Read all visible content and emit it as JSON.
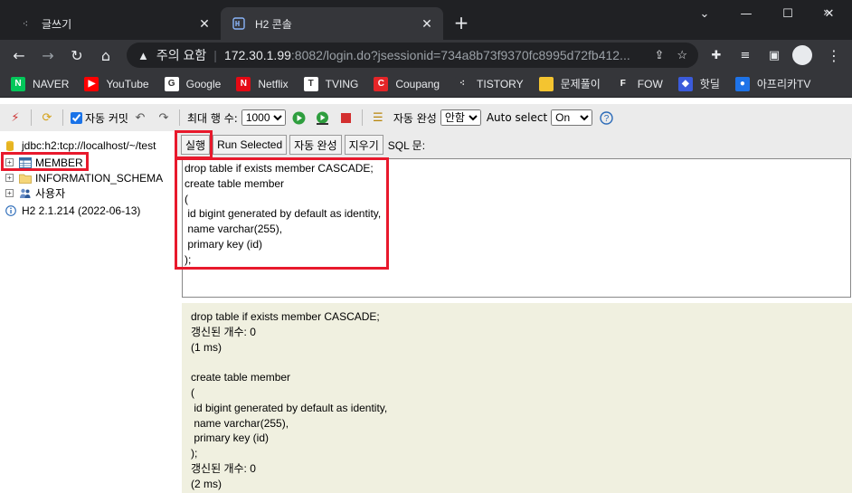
{
  "browser": {
    "tabs": [
      {
        "title": "글쓰기",
        "favicon": "tistory-dots-icon",
        "active": false
      },
      {
        "title": "H2 콘솔",
        "favicon": "h2-icon",
        "active": true
      }
    ],
    "window_controls": [
      "chevron-down-icon",
      "minimize-icon",
      "maximize-icon",
      "close-icon"
    ],
    "address": {
      "security": "주의 요함",
      "host": "172.30.1.99",
      "path": ":8082/login.do?jsessionid=734a8b73f9370fc8995d72fb412..."
    },
    "bookmarks": [
      {
        "label": "NAVER",
        "color": "#03c75a",
        "glyph": "N"
      },
      {
        "label": "YouTube",
        "color": "#ff0000",
        "glyph": "▶"
      },
      {
        "label": "Google",
        "color": "#ffffff",
        "glyph": "G"
      },
      {
        "label": "Netflix",
        "color": "#e50914",
        "glyph": "N"
      },
      {
        "label": "TVING",
        "color": "#ffffff",
        "glyph": "T"
      },
      {
        "label": "Coupang",
        "color": "#e52528",
        "glyph": "C"
      },
      {
        "label": "TISTORY",
        "color": "#35363a",
        "glyph": "⁖"
      },
      {
        "label": "문제풀이",
        "color": "#f4c430",
        "glyph": ""
      },
      {
        "label": "FOW",
        "color": "#35363a",
        "glyph": "F"
      },
      {
        "label": "핫딜",
        "color": "#3b5bdb",
        "glyph": "◆"
      },
      {
        "label": "아프리카TV",
        "color": "#1e73e8",
        "glyph": "●"
      }
    ]
  },
  "h2": {
    "toolbar": {
      "autocommit_label": "자동 커밋",
      "maxrows_label": "최대 행 수:",
      "maxrows_value": "1000",
      "autocomplete_label": "자동 완성",
      "autocomplete_value": "안함",
      "autoselect_label": "Auto select",
      "autoselect_value": "On"
    },
    "tree": {
      "connection": "jdbc:h2:tcp://localhost/~/test",
      "items": [
        "MEMBER",
        "INFORMATION_SCHEMA",
        "사용자"
      ],
      "version": "H2 2.1.214 (2022-06-13)"
    },
    "sqlbar": {
      "run": "실행",
      "run_selected": "Run Selected",
      "autocomplete": "자동 완성",
      "clear": "지우기",
      "sql_label": "SQL 문:"
    },
    "editor_text": "drop table if exists member CASCADE;\ncreate table member\n(\n id bigint generated by default as identity,\n name varchar(255),\n primary key (id)\n);",
    "result_text": "drop table if exists member CASCADE;\n갱신된 개수: 0\n(1 ms)\n\ncreate table member\n(\n id bigint generated by default as identity,\n name varchar(255),\n primary key (id)\n);\n갱신된 개수: 0\n(2 ms)"
  },
  "colors": {
    "highlight": "#e8192c",
    "result_bg": "#f0f0e0"
  }
}
